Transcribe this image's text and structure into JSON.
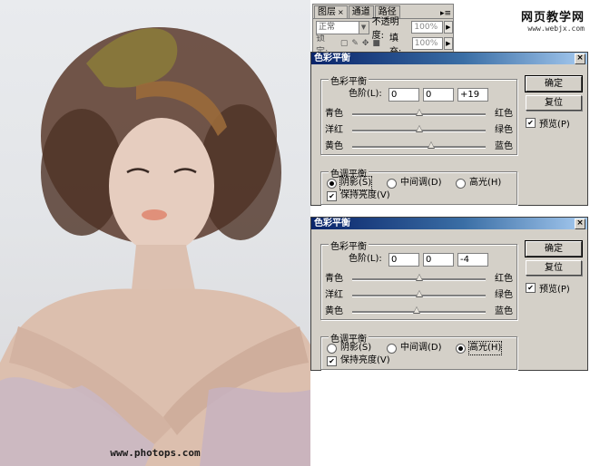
{
  "photo": {
    "watermark": "www.photops.com"
  },
  "site_badge": {
    "title": "网页教学网",
    "url": "www.webjx.com"
  },
  "layers_panel": {
    "tabs": [
      "图层",
      "通道",
      "路径"
    ],
    "blend_mode": "正常",
    "opacity_label": "不透明度:",
    "opacity_value": "100%",
    "lock_label": "锁定:",
    "fill_label": "填充:",
    "fill_value": "100%"
  },
  "dialogs": [
    {
      "title": "色彩平衡",
      "color_balance_group": "色彩平衡",
      "levels_label": "色阶(L):",
      "levels": [
        "0",
        "0",
        "+19"
      ],
      "sliders": [
        {
          "left": "青色",
          "right": "红色",
          "value": 0
        },
        {
          "left": "洋红",
          "right": "绿色",
          "value": 0
        },
        {
          "left": "黄色",
          "right": "蓝色",
          "value": 19
        }
      ],
      "tone_group": "色调平衡",
      "tones": [
        {
          "label": "阴影(S)",
          "selected": true
        },
        {
          "label": "中间调(D)",
          "selected": false
        },
        {
          "label": "高光(H)",
          "selected": false
        }
      ],
      "preserve_luminosity": "保持亮度(V)",
      "preserve_checked": true,
      "ok_label": "确定",
      "reset_label": "复位",
      "preview_label": "预览(P)",
      "preview_checked": true
    },
    {
      "title": "色彩平衡",
      "color_balance_group": "色彩平衡",
      "levels_label": "色阶(L):",
      "levels": [
        "0",
        "0",
        "-4"
      ],
      "sliders": [
        {
          "left": "青色",
          "right": "红色",
          "value": 0
        },
        {
          "left": "洋红",
          "right": "绿色",
          "value": 0
        },
        {
          "left": "黄色",
          "right": "蓝色",
          "value": -4
        }
      ],
      "tone_group": "色调平衡",
      "tones": [
        {
          "label": "阴影(S)",
          "selected": false
        },
        {
          "label": "中间调(D)",
          "selected": false
        },
        {
          "label": "高光(H)",
          "selected": true
        }
      ],
      "preserve_luminosity": "保持亮度(V)",
      "preserve_checked": true,
      "ok_label": "确定",
      "reset_label": "复位",
      "preview_label": "预览(P)",
      "preview_checked": true
    }
  ]
}
